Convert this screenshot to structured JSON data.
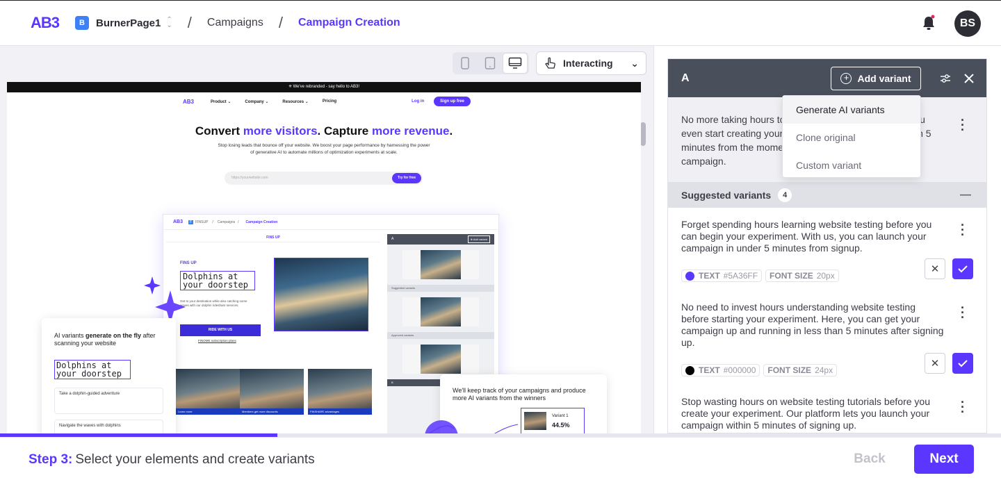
{
  "header": {
    "logo": "AB3",
    "project_badge": "B",
    "project_name": "BurnerPage1",
    "breadcrumbs": [
      "Campaigns",
      "Campaign Creation"
    ],
    "avatar_initials": "BS"
  },
  "toolbar": {
    "devices": [
      "mobile-icon",
      "tablet-icon",
      "desktop-icon"
    ],
    "active_device": "desktop",
    "mode_label": "Interacting"
  },
  "preview": {
    "banner": "✳ We've rebranded - say hello to AB3!",
    "nav_logo": "AB3",
    "nav_items": [
      "Product ⌄",
      "Company ⌄",
      "Resources ⌄",
      "Pricing"
    ],
    "login": "Log in",
    "signup": "Sign up free",
    "hero_title_1": "Convert ",
    "hero_title_hl1": "more visitors",
    "hero_title_2": ". Capture ",
    "hero_title_hl2": "more revenue",
    "hero_title_3": ".",
    "hero_sub_1": "Stop losing leads that bounce off your website. We boost your page performance by harnessing the power",
    "hero_sub_2": "of generative AI to automate millions of optimization experiments at scale.",
    "form_placeholder": "https://yourwebsite.com",
    "form_button": "Try for free",
    "mock": {
      "logo": "AB3",
      "project": "FINSUP",
      "crumb1": "Campaigns",
      "crumb2": "Campaign Creation",
      "site_name": "FINS UP",
      "fins_label": "FINS UP",
      "headline": "Dolphins at your doorstep",
      "body": "Get to your destination while also catching some waves with our dolphin rideshare services.",
      "cta": "RIDE WITH US",
      "link": "FINOME subscription plans",
      "panel_label": "A",
      "panel_add": "⊕ Add variant",
      "suggested": "Suggested variants",
      "approved": "Approved variants",
      "panel_b": "B",
      "thumb_caps": [
        "Learn more",
        "Members get more discounts",
        "FINSHARE advantages"
      ]
    },
    "card_ai": {
      "text_1": "AI variants ",
      "text_bold": "generate on the fly",
      "text_2": " after scanning your website",
      "headline": "Dolphins at your doorstep",
      "row1": "Take a dolphin-guided adventure",
      "row2": "Navigate the waves with dolphins"
    },
    "card_track": {
      "text": "We'll keep track of your campaigns and produce more AI variants from the winners",
      "variant_label": "Variant 1",
      "variant_pct": "44.5%"
    }
  },
  "panel": {
    "title": "A",
    "add_variant": "Add variant",
    "original_text": "No more taking hours to learn website testing before you even start creating your experiment. Launch in less than 5 minutes from the moment you sign up and launch your campaign.",
    "suggested_title": "Suggested variants",
    "suggested_count": "4",
    "variants": [
      {
        "text": "Forget spending hours learning website testing before you can begin your experiment. With us, you can launch your campaign in under 5 minutes from signup.",
        "color": "#5A36FF",
        "color_label": "TEXT",
        "font_label": "FONT SIZE",
        "font_size": "20px"
      },
      {
        "text": "No need to invest hours understanding website testing before starting your experiment. Here, you can get your campaign up and running in less than 5 minutes after signing up.",
        "color": "#000000",
        "color_label": "TEXT",
        "font_label": "FONT SIZE",
        "font_size": "24px"
      },
      {
        "text": "Stop wasting hours on website testing tutorials before you create your experiment. Our platform lets you launch your campaign within 5 minutes of signing up."
      }
    ]
  },
  "dropdown": {
    "items": [
      "Generate AI variants",
      "Clone original",
      "Custom variant"
    ]
  },
  "footer": {
    "step_label": "Step 3:",
    "step_text": "Select your elements and create variants",
    "back": "Back",
    "next": "Next",
    "progress": 0.277
  },
  "colors": {
    "accent": "#5A36FF",
    "panel_header": "#4A4F5C"
  }
}
